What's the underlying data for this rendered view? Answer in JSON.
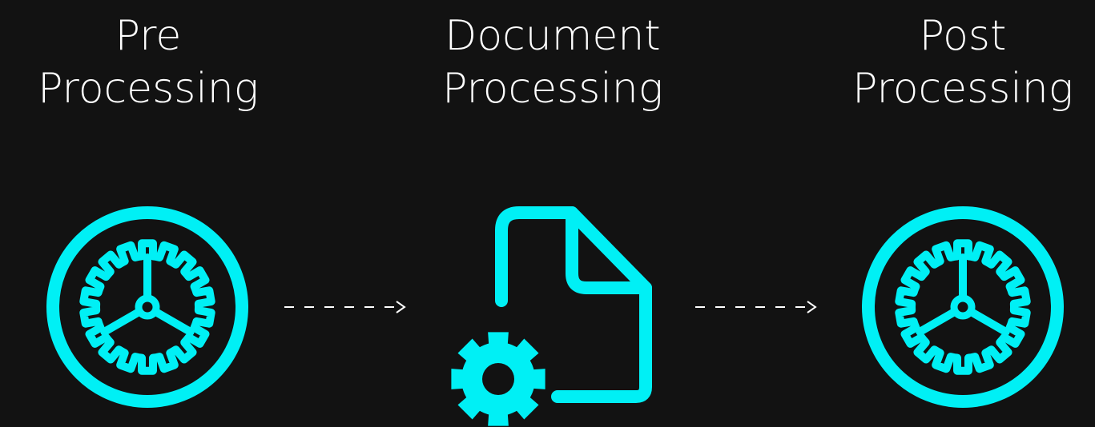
{
  "stages": [
    {
      "line1": "Pre",
      "line2": "Processing",
      "icon": "gear-circle-icon"
    },
    {
      "line1": "Document",
      "line2": "Processing",
      "icon": "document-gear-icon"
    },
    {
      "line1": "Post",
      "line2": "Processing",
      "icon": "gear-circle-icon"
    }
  ],
  "colors": {
    "background": "#121212",
    "accent": "#00F0F5",
    "text": "#FFFFFF"
  }
}
